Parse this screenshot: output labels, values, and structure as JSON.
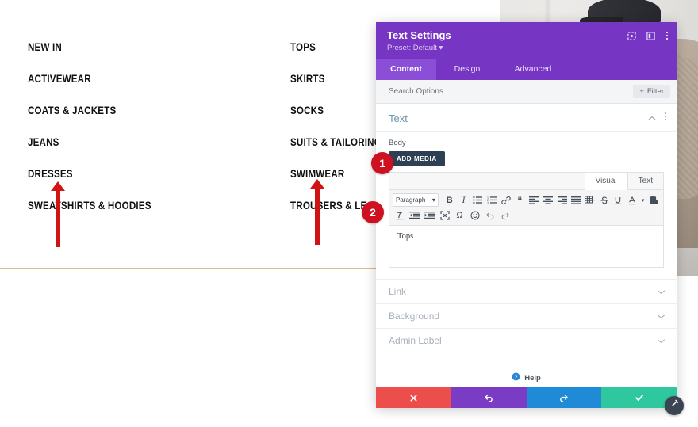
{
  "site": {
    "menu_left": [
      "NEW IN",
      "ACTIVEWEAR",
      "COATS & JACKETS",
      "JEANS",
      "DRESSES",
      "SWEATSHIRTS & HOODIES"
    ],
    "menu_right": [
      "TOPS",
      "SKIRTS",
      "SOCKS",
      "SUITS & TAILORING",
      "SWIMWEAR",
      "TROUSERS & LEGGINGS"
    ],
    "divider_color": "#d9b98a",
    "arrow_color": "#d01414"
  },
  "annotations": [
    {
      "number": "1"
    },
    {
      "number": "2"
    }
  ],
  "modal": {
    "title": "Text Settings",
    "preset": "Preset: Default",
    "accent_color": "#7635c2",
    "header_icons": [
      {
        "name": "expand-icon"
      },
      {
        "name": "layout-icon"
      },
      {
        "name": "more-vertical-icon"
      }
    ],
    "tabs": [
      {
        "label": "Content",
        "active": true
      },
      {
        "label": "Design",
        "active": false
      },
      {
        "label": "Advanced",
        "active": false
      }
    ],
    "search": {
      "placeholder": "Search Options",
      "value": ""
    },
    "filter_button": {
      "label": "Filter",
      "icon": "plus-icon"
    },
    "section": {
      "title": "Text",
      "collapse_icon": "chevron-up-icon",
      "more_icon": "more-vertical-icon"
    },
    "body_label": "Body",
    "add_media_label": "ADD MEDIA",
    "editor": {
      "view_tabs": [
        {
          "label": "Visual",
          "active": true
        },
        {
          "label": "Text",
          "active": false
        }
      ],
      "format_select": "Paragraph",
      "toolbar_row1": [
        "bold-icon",
        "italic-icon",
        "bulleted-list-icon",
        "numbered-list-icon",
        "link-icon",
        "blockquote-icon",
        "align-left-icon",
        "align-center-icon",
        "align-right-icon",
        "justify-icon",
        "table-icon",
        "strikethrough-icon",
        "underline-icon",
        "text-color-icon",
        "paste-icon"
      ],
      "toolbar_row2": [
        "clear-formatting-icon",
        "outdent-icon",
        "indent-icon",
        "fullscreen-icon",
        "special-character-icon",
        "emoji-icon",
        "undo-icon",
        "redo-icon"
      ],
      "content": "Tops"
    },
    "accordions": [
      {
        "label": "Link",
        "icon": "chevron-down-icon"
      },
      {
        "label": "Background",
        "icon": "chevron-down-icon"
      },
      {
        "label": "Admin Label",
        "icon": "chevron-down-icon"
      }
    ],
    "help": {
      "label": "Help",
      "icon": "question-circle-icon"
    },
    "footer_buttons": [
      {
        "name": "cancel",
        "icon": "close-icon",
        "color": "#ec4e4b"
      },
      {
        "name": "undo",
        "icon": "undo-icon",
        "color": "#7a3cc4"
      },
      {
        "name": "redo",
        "icon": "redo-icon",
        "color": "#1f8ad6"
      },
      {
        "name": "save",
        "icon": "check-icon",
        "color": "#2fc79d"
      }
    ]
  },
  "float_toggle": {
    "icon": "magic-wand-icon"
  }
}
